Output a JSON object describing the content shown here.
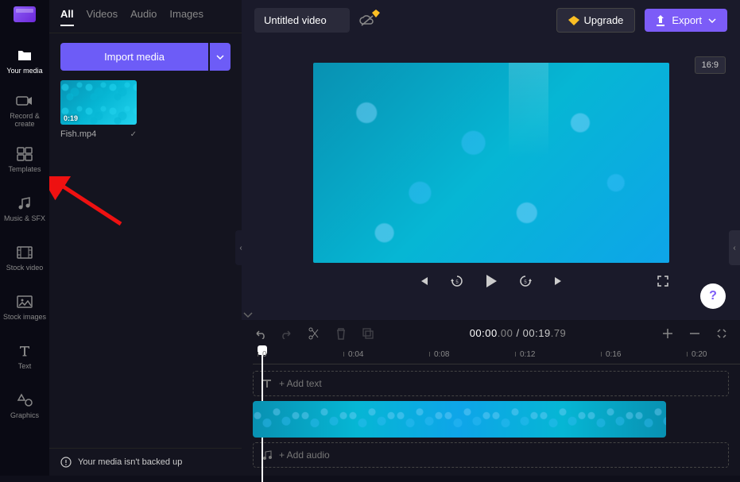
{
  "sidebar": {
    "items": [
      {
        "label": "Your media"
      },
      {
        "label": "Record & create"
      },
      {
        "label": "Templates"
      },
      {
        "label": "Music & SFX"
      },
      {
        "label": "Stock video"
      },
      {
        "label": "Stock images"
      },
      {
        "label": "Text"
      },
      {
        "label": "Graphics"
      }
    ]
  },
  "media": {
    "tabs": [
      "All",
      "Videos",
      "Audio",
      "Images"
    ],
    "active_tab": 0,
    "import_label": "Import media",
    "items": [
      {
        "name": "Fish.mp4",
        "duration": "0:19"
      }
    ],
    "backup_msg": "Your media isn't backed up"
  },
  "topbar": {
    "title": "Untitled video",
    "upgrade": "Upgrade",
    "export": "Export",
    "aspect": "16:9"
  },
  "player": {
    "current_time": "00:00",
    "current_dec": ".00",
    "sep": " / ",
    "total_time": "00:19",
    "total_dec": ".79"
  },
  "timeline": {
    "marks": [
      {
        "label": "0",
        "pos": 12
      },
      {
        "label": "0:04",
        "pos": 120
      },
      {
        "label": "0:08",
        "pos": 228
      },
      {
        "label": "0:12",
        "pos": 336
      },
      {
        "label": "0:16",
        "pos": 444
      },
      {
        "label": "0:20",
        "pos": 552
      }
    ],
    "add_text": "+ Add text",
    "add_audio": "+ Add audio"
  },
  "help": "?"
}
